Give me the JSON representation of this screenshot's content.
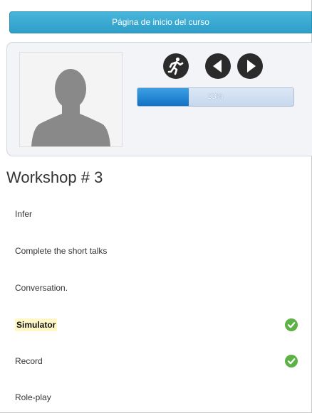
{
  "header": {
    "course_home_label": "Página de inicio del curso"
  },
  "profile": {
    "avatar_icon": "user-silhouette-icon",
    "controls": [
      {
        "name": "running-person-icon"
      },
      {
        "name": "previous-arrow-icon"
      },
      {
        "name": "next-arrow-icon"
      }
    ],
    "progress": {
      "value": 0.33,
      "label": "33%"
    }
  },
  "section": {
    "title": "Workshop # 3"
  },
  "activities": [
    {
      "label": "Infer",
      "highlighted": false,
      "completed": false
    },
    {
      "label": "Complete the short talks",
      "highlighted": false,
      "completed": false
    },
    {
      "label": "Conversation.",
      "highlighted": false,
      "completed": false
    },
    {
      "label": "Simulator",
      "highlighted": true,
      "completed": true
    },
    {
      "label": "Record",
      "highlighted": false,
      "completed": true
    },
    {
      "label": "Role-play",
      "highlighted": false,
      "completed": false
    }
  ],
  "colors": {
    "header_blue": "#3aa8d2",
    "progress_blue": "#1e82d2",
    "check_green": "#5cb244",
    "highlight_yellow": "#fff8c6"
  }
}
